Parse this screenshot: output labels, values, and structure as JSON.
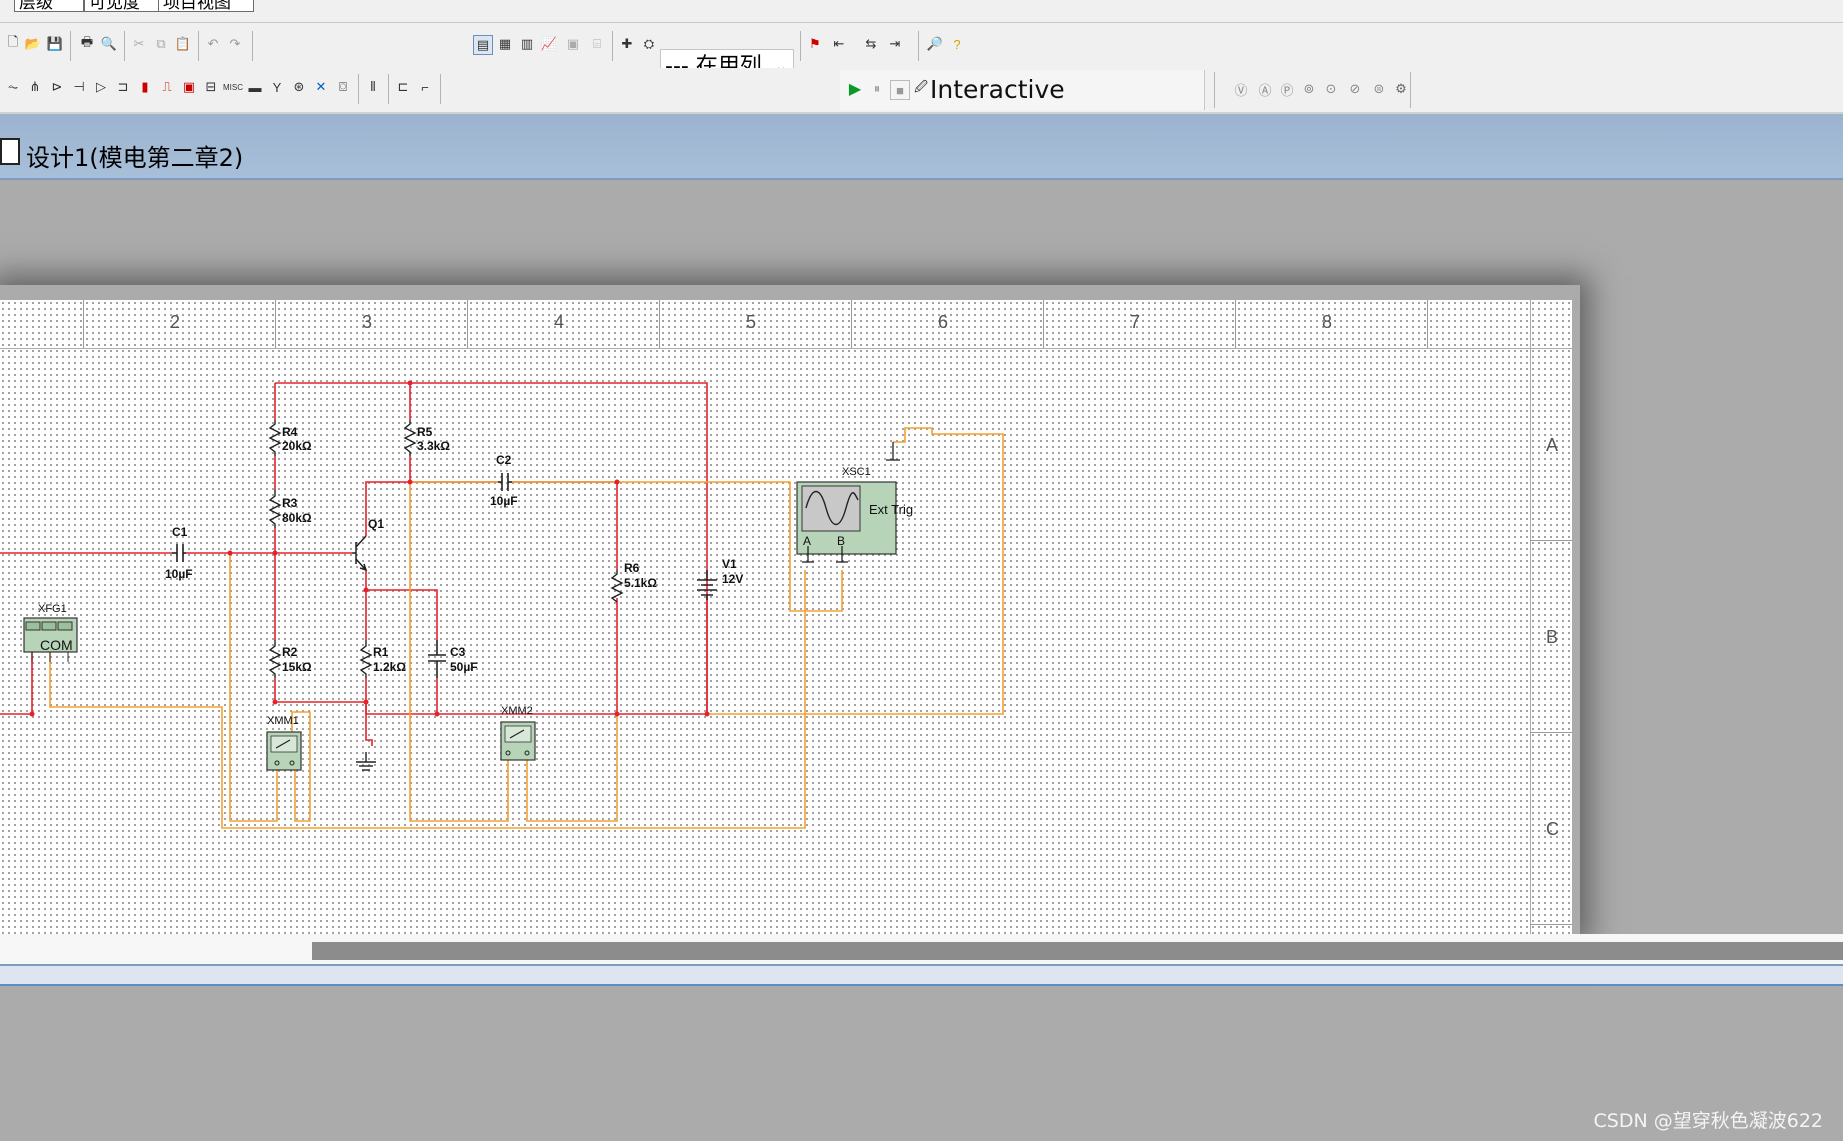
{
  "menu_tabs": [
    "层级",
    "可见度",
    "项目视图"
  ],
  "toolbar": {
    "in_use_list": "--- 在用列",
    "sim_mode": "Interactive"
  },
  "document": {
    "title": "设计1(模电第二章2)"
  },
  "sheet": {
    "columns": [
      "2",
      "3",
      "4",
      "5",
      "6",
      "7",
      "8"
    ],
    "rows": [
      "A",
      "B",
      "C"
    ]
  },
  "components": {
    "r4": {
      "ref": "R4",
      "value": "20kΩ"
    },
    "r3": {
      "ref": "R3",
      "value": "80kΩ"
    },
    "r5": {
      "ref": "R5",
      "value": "3.3kΩ"
    },
    "r2": {
      "ref": "R2",
      "value": "15kΩ"
    },
    "r1": {
      "ref": "R1",
      "value": "1.2kΩ"
    },
    "r6": {
      "ref": "R6",
      "value": "5.1kΩ"
    },
    "c1": {
      "ref": "C1",
      "value": "10µF"
    },
    "c2": {
      "ref": "C2",
      "value": "10µF"
    },
    "c3": {
      "ref": "C3",
      "value": "50µF"
    },
    "q1": {
      "ref": "Q1"
    },
    "v1": {
      "ref": "V1",
      "value": "12V"
    },
    "xsc1": {
      "ref": "XSC1",
      "ext_trig": "Ext Trig",
      "ch_a": "A",
      "ch_b": "B"
    },
    "xfg1": {
      "ref": "XFG1",
      "com": "COM"
    },
    "xmm1": {
      "ref": "XMM1"
    },
    "xmm2": {
      "ref": "XMM2"
    }
  },
  "colors": {
    "red_wire": "#e8202a",
    "orange_wire": "#f5a030",
    "instrument_fill": "#b8d4b8"
  },
  "watermark": "CSDN @望穿秋色凝波622"
}
